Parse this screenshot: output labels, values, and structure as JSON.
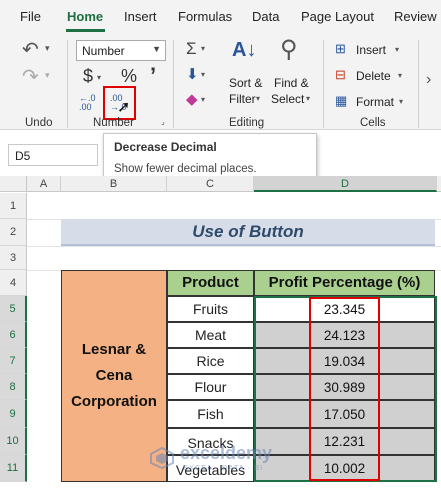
{
  "menu": {
    "tabs": [
      "File",
      "Home",
      "Insert",
      "Formulas",
      "Data",
      "Page Layout",
      "Review"
    ],
    "active": "Home"
  },
  "ribbon": {
    "undo_group_label": "Undo",
    "number_group_label": "Number",
    "number_format_value": "Number",
    "editing_group_label": "Editing",
    "sort_filter_label": "Sort &",
    "sort_filter_label2": "Filter",
    "find_select_label": "Find &",
    "find_select_label2": "Select",
    "cells_group_label": "Cells",
    "insert_label": "Insert",
    "delete_label": "Delete",
    "format_label": "Format",
    "increase_decimal_label": "←.0 .00",
    "decrease_decimal_label": ".00 →.0",
    "currency_symbol": "$",
    "percent_symbol": "%",
    "comma_symbol": "’"
  },
  "tooltip": {
    "title": "Decrease Decimal",
    "description": "Show fewer decimal places."
  },
  "name_box": {
    "value": "D5"
  },
  "grid": {
    "columns": [
      "A",
      "B",
      "C",
      "D"
    ],
    "rows": [
      "1",
      "2",
      "3",
      "4",
      "5",
      "6",
      "7",
      "8",
      "9",
      "10",
      "11"
    ],
    "selected_column": "D"
  },
  "sheet": {
    "title": "Use of Button",
    "company": "Lesnar &\nCena\nCorporation",
    "header_product": "Product",
    "header_profit": "Profit Percentage (%)",
    "rows": [
      {
        "product": "Fruits",
        "profit": "23.345"
      },
      {
        "product": "Meat",
        "profit": "24.123"
      },
      {
        "product": "Rice",
        "profit": "19.034"
      },
      {
        "product": "Flour",
        "profit": "30.989"
      },
      {
        "product": "Fish",
        "profit": "17.050"
      },
      {
        "product": "Snacks",
        "profit": "12.231"
      },
      {
        "product": "Vegetables",
        "profit": "10.002"
      }
    ]
  },
  "watermark": {
    "name": "exceldemy",
    "sub": "EXCEL · DATA · BI"
  },
  "colors": {
    "accent": "#1e7145",
    "header_green": "#a9d08e",
    "company_orange": "#f4b183",
    "title_blue": "#d6dde8",
    "highlight_red": "#e00000"
  }
}
